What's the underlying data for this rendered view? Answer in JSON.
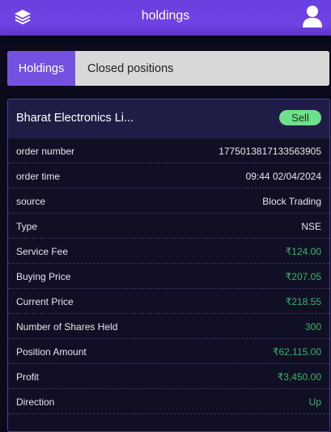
{
  "header": {
    "title": "holdings",
    "menu_icon": "layers-icon",
    "profile_icon": "user-icon"
  },
  "tabs": [
    {
      "label": "Holdings",
      "active": true
    },
    {
      "label": "Closed positions",
      "active": false
    }
  ],
  "position": {
    "name": "Bharat Electronics Li...",
    "badge": "Sell",
    "rows": [
      {
        "label": "order number",
        "value": "1775013817133563905",
        "color": "white"
      },
      {
        "label": "order time",
        "value": "09:44 02/04/2024",
        "color": "white"
      },
      {
        "label": "source",
        "value": "Block Trading",
        "color": "white"
      },
      {
        "label": "Type",
        "value": "NSE",
        "color": "white"
      },
      {
        "label": "Service Fee",
        "value": "₹124.00",
        "color": "green"
      },
      {
        "label": "Buying Price",
        "value": "₹207.05",
        "color": "green"
      },
      {
        "label": "Current Price",
        "value": "₹218.55",
        "color": "green"
      },
      {
        "label": "Number of Shares Held",
        "value": "300",
        "color": "green"
      },
      {
        "label": "Position Amount",
        "value": "₹62,115.00",
        "color": "green"
      },
      {
        "label": "Profit",
        "value": "₹3,450.00",
        "color": "green"
      },
      {
        "label": "Direction",
        "value": "Up",
        "color": "green"
      }
    ]
  },
  "colors": {
    "accent": "#7451e0",
    "header_gradient": "#6a3fe0",
    "positive": "#39b56a",
    "badge_bg": "#6ee08a",
    "background": "#0b0a1a"
  }
}
